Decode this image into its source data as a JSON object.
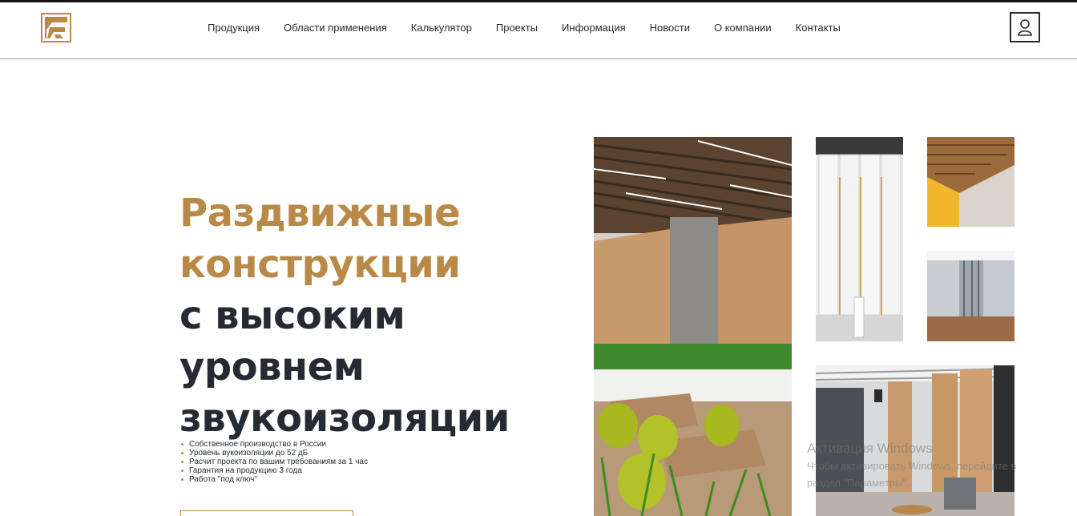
{
  "brand": {
    "logo_icon": "brand-logo-icon",
    "accent_color": "#b98a47",
    "text_color": "#262b33"
  },
  "nav": {
    "items": [
      {
        "label": "Продукция"
      },
      {
        "label": "Области применения"
      },
      {
        "label": "Калькулятор"
      },
      {
        "label": "Проекты"
      },
      {
        "label": "Информация"
      },
      {
        "label": "Новости"
      },
      {
        "label": "О компании"
      },
      {
        "label": "Контакты"
      }
    ],
    "account_icon": "user-icon"
  },
  "hero": {
    "title_line1": "Раздвижные",
    "title_line2": "конструкции",
    "title_line3": "с высоким",
    "title_line4": "уровнем",
    "title_line5": "звукоизоляции",
    "features": [
      "Собственное производство в России",
      "Уровень вукоизоляции до 52 дБ",
      "Расчит проекта по вашим требованиям за 1 час",
      "Гарантия на продукцию 3 года",
      "Работа \"под ключ\""
    ],
    "cta_label": ""
  },
  "gallery": {
    "images": [
      {
        "icon": "cafe-wood-partition-photo"
      },
      {
        "icon": "white-partition-hall-photo"
      },
      {
        "icon": "wood-ceiling-corner-photo"
      },
      {
        "icon": "glass-partition-room-photo"
      },
      {
        "icon": "lounge-partition-photo"
      }
    ]
  },
  "watermark": {
    "title": "Активация Windows",
    "subtitle_line1": "Чтобы активировать Windows, перейдите в",
    "subtitle_line2": "раздел \"Параметры\"."
  }
}
